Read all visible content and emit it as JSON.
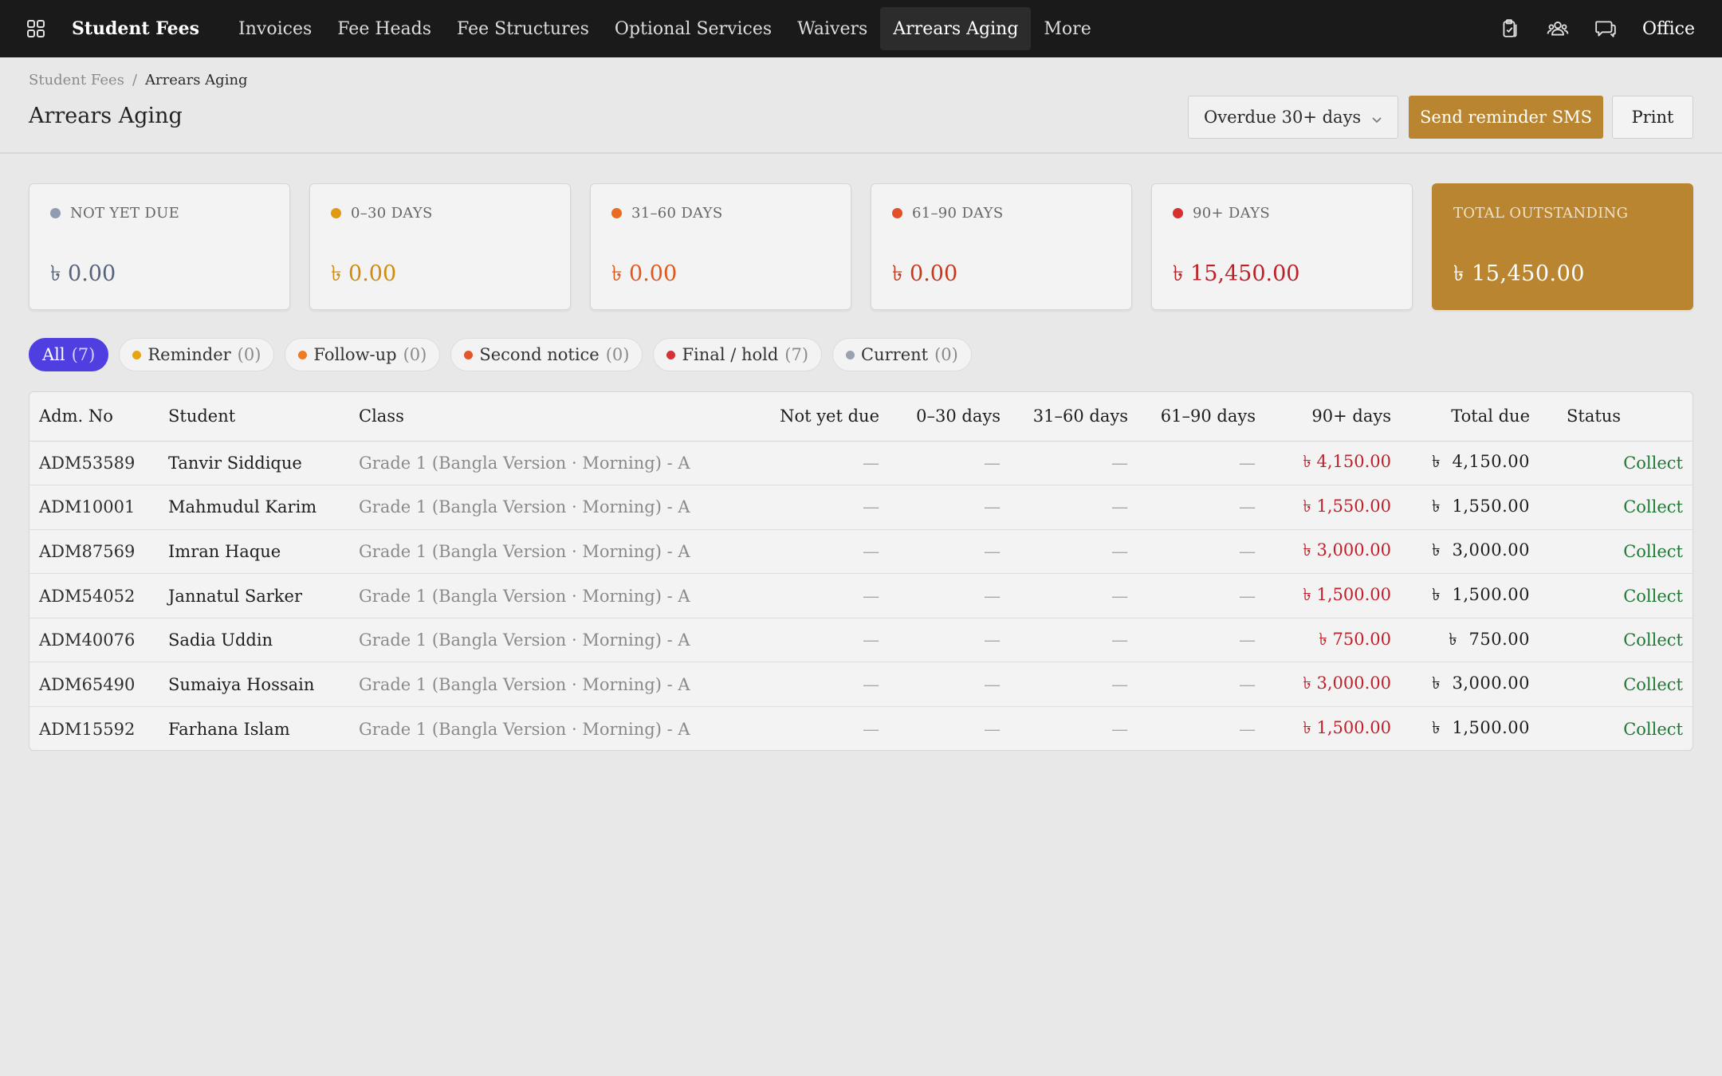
{
  "nav": {
    "brand": "Student Fees",
    "links": [
      "Invoices",
      "Fee Heads",
      "Fee Structures",
      "Optional Services",
      "Waivers",
      "Arrears Aging",
      "More"
    ],
    "active_index": 5,
    "right_icons": [
      "clipboard-check-icon",
      "users-icon",
      "chat-icon"
    ],
    "office_label": "Office"
  },
  "breadcrumb": {
    "parent": "Student Fees",
    "separator": "/",
    "current": "Arrears Aging"
  },
  "page_title": "Arrears Aging",
  "toolbar": {
    "overdue_filter": "Overdue 30+ days",
    "send_sms_label": "Send reminder SMS",
    "print_label": "Print"
  },
  "cards": [
    {
      "label": "NOT YET DUE",
      "value": "৳ 0.00",
      "dot_color": "#8e9bb1",
      "value_color": "#55627a"
    },
    {
      "label": "0–30 DAYS",
      "value": "৳ 0.00",
      "dot_color": "#e09a12",
      "value_color": "#cf8b0f"
    },
    {
      "label": "31–60 DAYS",
      "value": "৳ 0.00",
      "dot_color": "#ea6a22",
      "value_color": "#e3571a"
    },
    {
      "label": "61–90 DAYS",
      "value": "৳ 0.00",
      "dot_color": "#e2502a",
      "value_color": "#c8391b"
    },
    {
      "label": "90+ DAYS",
      "value": "৳ 15,450.00",
      "dot_color": "#d6302f",
      "value_color": "#bf1f26"
    },
    {
      "label": "TOTAL OUTSTANDING",
      "value": "৳ 15,450.00"
    }
  ],
  "chips": [
    {
      "label": "All",
      "count": "(7)",
      "dot_color": null,
      "active": true
    },
    {
      "label": "Reminder",
      "count": "(0)",
      "dot_color": "#e8a512"
    },
    {
      "label": "Follow-up",
      "count": "(0)",
      "dot_color": "#f07a21"
    },
    {
      "label": "Second notice",
      "count": "(0)",
      "dot_color": "#e5532a"
    },
    {
      "label": "Final / hold",
      "count": "(7)",
      "dot_color": "#d63136"
    },
    {
      "label": "Current",
      "count": "(0)",
      "dot_color": "#9aa2b1"
    }
  ],
  "table": {
    "headers": [
      "Adm. No",
      "Student",
      "Class",
      "Not yet due",
      "0–30 days",
      "31–60 days",
      "61–90 days",
      "90+ days",
      "Total due",
      "Status"
    ],
    "empty_cell": "—",
    "action_label": "Collect",
    "rows": [
      {
        "adm": "ADM53589",
        "student": "Tanvir Siddique",
        "class": "Grade 1 (Bangla Version · Morning) - A",
        "d90": "৳ 4,150.00",
        "total": "৳  4,150.00"
      },
      {
        "adm": "ADM10001",
        "student": "Mahmudul Karim",
        "class": "Grade 1 (Bangla Version · Morning) - A",
        "d90": "৳ 1,550.00",
        "total": "৳  1,550.00"
      },
      {
        "adm": "ADM87569",
        "student": "Imran Haque",
        "class": "Grade 1 (Bangla Version · Morning) - A",
        "d90": "৳ 3,000.00",
        "total": "৳  3,000.00"
      },
      {
        "adm": "ADM54052",
        "student": "Jannatul Sarker",
        "class": "Grade 1 (Bangla Version · Morning) - A",
        "d90": "৳ 1,500.00",
        "total": "৳  1,500.00"
      },
      {
        "adm": "ADM40076",
        "student": "Sadia Uddin",
        "class": "Grade 1 (Bangla Version · Morning) - A",
        "d90": "৳ 750.00",
        "total": "৳  750.00"
      },
      {
        "adm": "ADM65490",
        "student": "Sumaiya Hossain",
        "class": "Grade 1 (Bangla Version · Morning) - A",
        "d90": "৳ 3,000.00",
        "total": "৳  3,000.00"
      },
      {
        "adm": "ADM15592",
        "student": "Farhana Islam",
        "class": "Grade 1 (Bangla Version · Morning) - A",
        "d90": "৳ 1,500.00",
        "total": "৳  1,500.00"
      }
    ]
  }
}
